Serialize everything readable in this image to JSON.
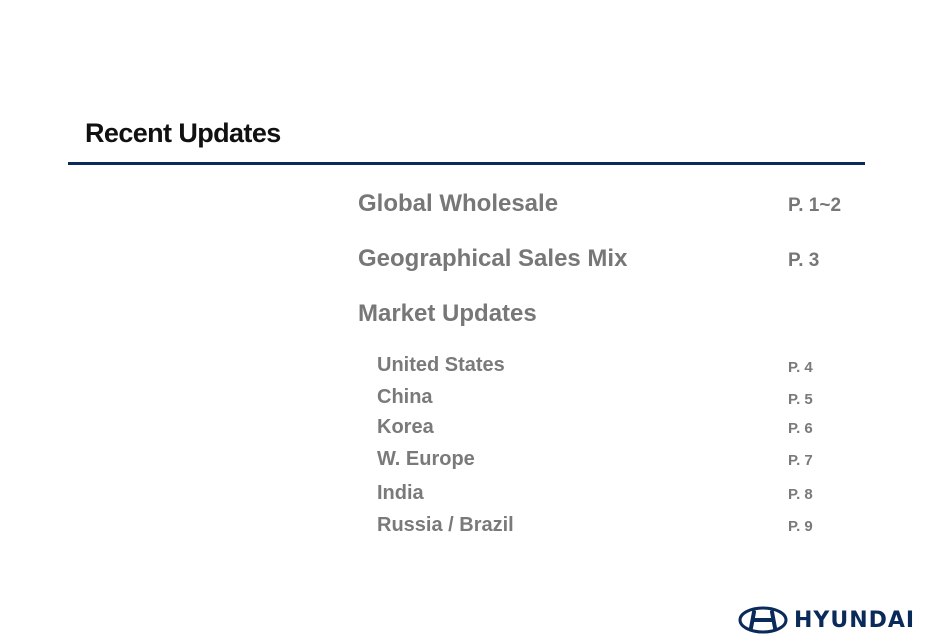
{
  "title": "Recent Updates",
  "sections": [
    {
      "label": "Global Wholesale",
      "page": "P. 1~2"
    },
    {
      "label": "Geographical Sales Mix",
      "page": "P. 3"
    },
    {
      "label": "Market Updates",
      "page": ""
    }
  ],
  "markets": [
    {
      "label": "United States",
      "page": "P. 4"
    },
    {
      "label": "China",
      "page": "P. 5"
    },
    {
      "label": "Korea",
      "page": "P. 6"
    },
    {
      "label": "W. Europe",
      "page": "P. 7"
    },
    {
      "label": "India",
      "page": "P. 8"
    },
    {
      "label": "Russia / Brazil",
      "page": "P. 9"
    }
  ],
  "logo": {
    "text": "HYUNDAI",
    "color": "#0a2a5a"
  },
  "colors": {
    "rule": "#0a2a5a",
    "text": "#777777"
  }
}
